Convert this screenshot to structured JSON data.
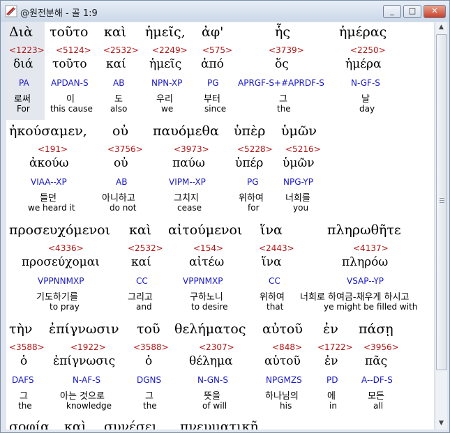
{
  "window": {
    "title": "@원전분해 - 골 1:9"
  },
  "window_buttons": {
    "minimize": "_",
    "maximize": "□",
    "close": "✕"
  },
  "rows": [
    {
      "words": [
        {
          "greek": "Διὰ",
          "strongs": "<1223>",
          "lexeme": "διά",
          "parsing": "PA",
          "korean": "로써",
          "english": "For"
        },
        {
          "greek": "τοῦτο",
          "strongs": "<5124>",
          "lexeme": "τοῦτο",
          "parsing": "APDAN-S",
          "korean": "이",
          "english": "this cause"
        },
        {
          "greek": "καὶ",
          "strongs": "<2532>",
          "lexeme": "καί",
          "parsing": "AB",
          "korean": "도",
          "english": "also"
        },
        {
          "greek": "ἡμεῖς,",
          "strongs": "<2249>",
          "lexeme": "ἡμεῖς",
          "parsing": "NPN-XP",
          "korean": "우리",
          "english": "we"
        },
        {
          "greek": "ἀφ'",
          "strongs": "<575>",
          "lexeme": "ἀπό",
          "parsing": "PG",
          "korean": "부터",
          "english": "since"
        },
        {
          "greek": "ἧς",
          "strongs": "<3739>",
          "lexeme": "ὅς",
          "parsing": "APRGF-S+#APRDF-S",
          "korean": "그",
          "english": "the"
        },
        {
          "greek": "ἡμέρας",
          "strongs": "<2250>",
          "lexeme": "ἡμέρα",
          "parsing": "N-GF-S",
          "korean": "날",
          "english": "day"
        }
      ]
    },
    {
      "words": [
        {
          "greek": "ἠκούσαμεν,",
          "strongs": "<191>",
          "lexeme": "ἀκούω",
          "parsing": "VIAA--XP",
          "korean": "들던",
          "english": "we heard it"
        },
        {
          "greek": "οὐ",
          "strongs": "<3756>",
          "lexeme": "οὐ",
          "parsing": "AB",
          "korean": "아니하고",
          "english": "do not"
        },
        {
          "greek": "παυόμεθα",
          "strongs": "<3973>",
          "lexeme": "παύω",
          "parsing": "VIPM--XP",
          "korean": "그치지",
          "english": "cease"
        },
        {
          "greek": "ὑπὲρ",
          "strongs": "<5228>",
          "lexeme": "ὑπέρ",
          "parsing": "PG",
          "korean": "위하여",
          "english": "for"
        },
        {
          "greek": "ὑμῶν",
          "strongs": "<5216>",
          "lexeme": "ὑμῶν",
          "parsing": "NPG-YP",
          "korean": "너희를",
          "english": "you"
        }
      ]
    },
    {
      "words": [
        {
          "greek": "προσευχόμενοι",
          "strongs": "<4336>",
          "lexeme": "προσεύχομαι",
          "parsing": "VPPNNMXP",
          "korean": "기도하기를",
          "english": "to pray"
        },
        {
          "greek": "καὶ",
          "strongs": "<2532>",
          "lexeme": "καί",
          "parsing": "CC",
          "korean": "그리고",
          "english": "and"
        },
        {
          "greek": "αἰτούμενοι",
          "strongs": "<154>",
          "lexeme": "αἰτέω",
          "parsing": "VPPNMXP",
          "korean": "구하노니",
          "english": "to desire"
        },
        {
          "greek": "ἵνα",
          "strongs": "<2443>",
          "lexeme": "ἵνα",
          "parsing": "CC",
          "korean": "위하여",
          "english": "that"
        },
        {
          "greek": "πληρωθῆτε",
          "strongs": "<4137>",
          "lexeme": "πληρόω",
          "parsing": "VSAP--YP",
          "korean": "너희로 하여금-채우게 하시고",
          "english": "ye might be filled with"
        }
      ]
    },
    {
      "words": [
        {
          "greek": "τὴν",
          "strongs": "<3588>",
          "lexeme": "ὁ",
          "parsing": "DAFS",
          "korean": "그",
          "english": "the"
        },
        {
          "greek": "ἐπίγνωσιν",
          "strongs": "<1922>",
          "lexeme": "ἐπίγνωσις",
          "parsing": "N-AF-S",
          "korean": "아는 것으로",
          "english": "knowledge"
        },
        {
          "greek": "τοῦ",
          "strongs": "<3588>",
          "lexeme": "ὁ",
          "parsing": "DGNS",
          "korean": "그",
          "english": "the"
        },
        {
          "greek": "θελήματος",
          "strongs": "<2307>",
          "lexeme": "θέλημα",
          "parsing": "N-GN-S",
          "korean": "뜻을",
          "english": "of will"
        },
        {
          "greek": "αὐτοῦ",
          "strongs": "<848>",
          "lexeme": "αὑτοῦ",
          "parsing": "NPGMZS",
          "korean": "하나님의",
          "english": "his"
        },
        {
          "greek": "ἐν",
          "strongs": "<1722>",
          "lexeme": "ἐν",
          "parsing": "PD",
          "korean": "에",
          "english": "in"
        },
        {
          "greek": "πάσῃ",
          "strongs": "<3956>",
          "lexeme": "πᾶς",
          "parsing": "A--DF-S",
          "korean": "모든",
          "english": "all"
        }
      ]
    },
    {
      "words": [
        {
          "greek": "σοφίᾳ"
        },
        {
          "greek": "καὶ"
        },
        {
          "greek": "συνέσει"
        },
        {
          "greek": "πνευματικῇ"
        }
      ]
    }
  ]
}
